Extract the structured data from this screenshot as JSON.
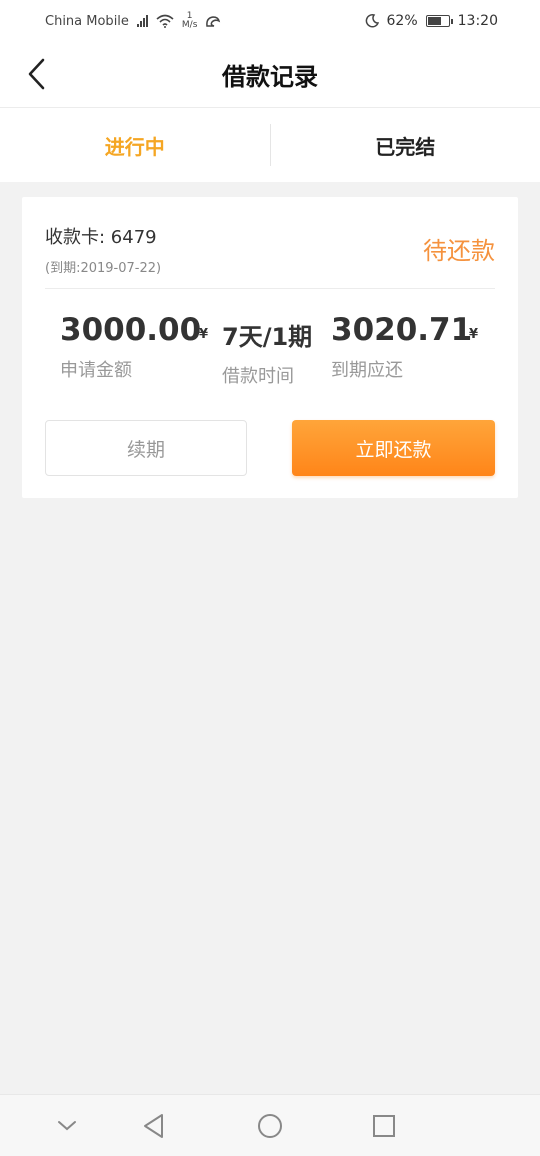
{
  "status_bar": {
    "carrier": "China Mobile",
    "net_speed_value": "1",
    "net_speed_unit": "M/s",
    "battery": "62%",
    "time": "13:20"
  },
  "header": {
    "title": "借款记录"
  },
  "tabs": [
    {
      "label": "进行中",
      "active": true
    },
    {
      "label": "已完结",
      "active": false
    }
  ],
  "loan": {
    "card_label": "收款卡: 6479",
    "due_date": "(到期:2019-07-22)",
    "status": "待还款",
    "amount": "3000.00",
    "amount_currency": "¥",
    "amount_label": "申请金额",
    "term": "7天/1期",
    "term_label": "借款时间",
    "due_amount": "3020.71",
    "due_currency": "¥",
    "due_label": "到期应还",
    "renew_label": "续期",
    "repay_label": "立即还款"
  },
  "colors": {
    "accent": "#f5a623",
    "status": "#f5923e",
    "button_gradient_top": "#ffa53a",
    "button_gradient_bottom": "#ff8519"
  },
  "icons": {
    "back": "chevron-left-icon",
    "nav_down": "chevron-down-icon",
    "nav_back": "triangle-back-icon",
    "nav_home": "circle-home-icon",
    "nav_recent": "square-recent-icon"
  }
}
